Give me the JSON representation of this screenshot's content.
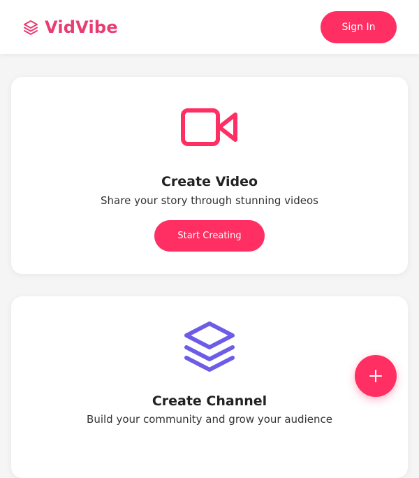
{
  "header": {
    "brand_name": "VidVibe",
    "brand_icon": "layers-icon",
    "signin_label": "Sign In"
  },
  "cards": [
    {
      "icon": "video-camera-icon",
      "title": "Create Video",
      "description": "Share your story through stunning videos",
      "button_label": "Start Creating"
    },
    {
      "icon": "layers-icon",
      "title": "Create Channel",
      "description": "Build your community and grow your audience"
    }
  ],
  "fab": {
    "icon": "plus-icon"
  },
  "colors": {
    "accent": "#ff2f63",
    "brand_text": "#e93d72",
    "channel_icon": "#6c5ce7",
    "background": "#f5f5f5"
  }
}
